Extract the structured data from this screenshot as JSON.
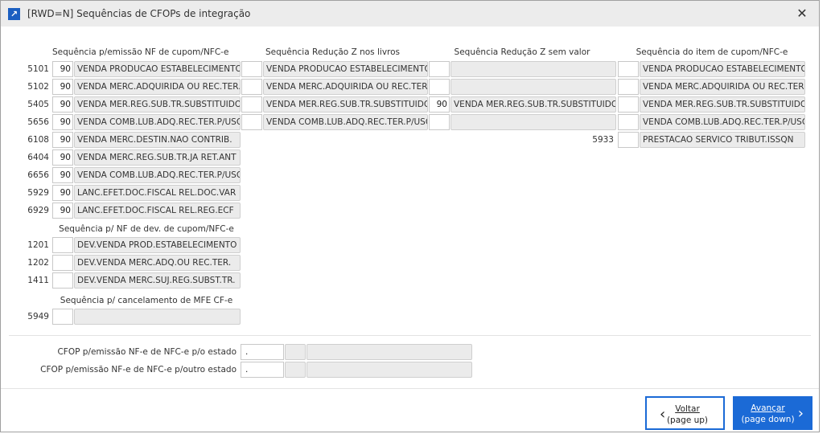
{
  "window": {
    "title": "[RWD=N] Sequências de CFOPs de integração",
    "close_icon": "close-icon",
    "app_icon": "arrow-up-right-icon"
  },
  "section1": {
    "headers": [
      "Sequência p/emissão NF de cupom/NFC-e",
      "Sequência Redução Z nos livros",
      "Sequência Redução Z sem valor",
      "Sequência do item de cupom/NFC-e"
    ],
    "rows": [
      {
        "code": "5101",
        "c1": {
          "seq": "90",
          "desc": "VENDA PRODUCAO ESTABELECIMENTO"
        },
        "c2": {
          "seq": "",
          "desc": "VENDA PRODUCAO ESTABELECIMENTO"
        },
        "c3": {
          "seq": "",
          "desc": ""
        },
        "c4": {
          "seq": "",
          "desc": "VENDA PRODUCAO ESTABELECIMENTO"
        }
      },
      {
        "code": "5102",
        "c1": {
          "seq": "90",
          "desc": "VENDA MERC.ADQUIRIDA OU REC.TER."
        },
        "c2": {
          "seq": "",
          "desc": "VENDA MERC.ADQUIRIDA OU REC.TER."
        },
        "c3": {
          "seq": "",
          "desc": ""
        },
        "c4": {
          "seq": "",
          "desc": "VENDA MERC.ADQUIRIDA OU REC.TER."
        }
      },
      {
        "code": "5405",
        "c1": {
          "seq": "90",
          "desc": "VENDA MER.REG.SUB.TR.SUBSTITUIDO"
        },
        "c2": {
          "seq": "",
          "desc": "VENDA MER.REG.SUB.TR.SUBSTITUIDO"
        },
        "c3": {
          "seq": "90",
          "desc": "VENDA MER.REG.SUB.TR.SUBSTITUIDO"
        },
        "c4": {
          "seq": "",
          "desc": "VENDA MER.REG.SUB.TR.SUBSTITUIDO"
        }
      },
      {
        "code": "5656",
        "c1": {
          "seq": "90",
          "desc": "VENDA COMB.LUB.ADQ.REC.TER.P/USO"
        },
        "c2": {
          "seq": "",
          "desc": "VENDA COMB.LUB.ADQ.REC.TER.P/USO"
        },
        "c3": {
          "seq": "",
          "desc": ""
        },
        "c4": {
          "seq": "",
          "desc": "VENDA COMB.LUB.ADQ.REC.TER.P/USO"
        }
      },
      {
        "code": "6108",
        "c1": {
          "seq": "90",
          "desc": "VENDA MERC.DESTIN.NAO CONTRIB."
        },
        "c4code": "5933",
        "c4": {
          "seq": "",
          "desc": "PRESTACAO SERVICO TRIBUT.ISSQN"
        }
      },
      {
        "code": "6404",
        "c1": {
          "seq": "90",
          "desc": "VENDA MERC.REG.SUB.TR.JA RET.ANT"
        }
      },
      {
        "code": "6656",
        "c1": {
          "seq": "90",
          "desc": "VENDA COMB.LUB.ADQ.REC.TER.P/USO"
        }
      },
      {
        "code": "5929",
        "c1": {
          "seq": "90",
          "desc": "LANC.EFET.DOC.FISCAL REL.DOC.VAR"
        }
      },
      {
        "code": "6929",
        "c1": {
          "seq": "90",
          "desc": "LANC.EFET.DOC.FISCAL REL.REG.ECF"
        }
      }
    ]
  },
  "section2": {
    "header": "Sequência p/ NF de dev. de cupom/NFC-e",
    "rows": [
      {
        "code": "1201",
        "c1": {
          "seq": "",
          "desc": "DEV.VENDA PROD.ESTABELECIMENTO"
        }
      },
      {
        "code": "1202",
        "c1": {
          "seq": "",
          "desc": "DEV.VENDA MERC.ADQ.OU REC.TER."
        }
      },
      {
        "code": "1411",
        "c1": {
          "seq": "",
          "desc": "DEV.VENDA MERC.SUJ.REG.SUBST.TR."
        }
      }
    ]
  },
  "section3": {
    "header": "Sequência p/ cancelamento de MFE CF-e",
    "rows": [
      {
        "code": "5949",
        "c1": {
          "seq": "",
          "desc": ""
        }
      }
    ]
  },
  "cfop": [
    {
      "label": "CFOP p/emissão NF-e de NFC-e p/o estado",
      "value": ".",
      "code": "",
      "desc": ""
    },
    {
      "label": "CFOP p/emissão NF-e de NFC-e p/outro estado",
      "value": ".",
      "code": "",
      "desc": ""
    }
  ],
  "buttons": {
    "back": {
      "line1": "Voltar",
      "line2": "(page up)",
      "icon": "chevron-left-icon"
    },
    "next": {
      "line1": "Avançar",
      "line2": "(page down)",
      "icon": "chevron-right-icon"
    }
  }
}
